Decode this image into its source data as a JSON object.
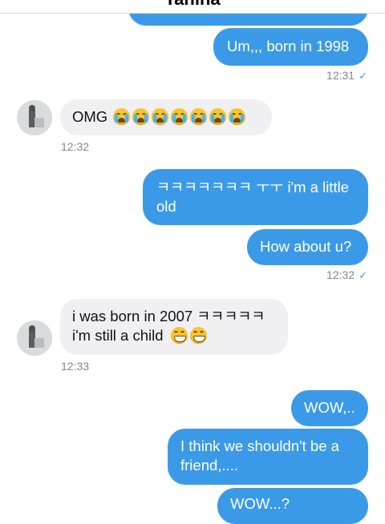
{
  "header": {
    "title": "Tahina"
  },
  "messages": {
    "m1": {
      "text": "Um,,, born in 1998"
    },
    "m1_time": "12:31",
    "m2": {
      "text": "OMG"
    },
    "m2_time": "12:32",
    "m3": {
      "line1": "ㅋㅋㅋㅋㅋㅋㅋ ㅜㅜ i'm a little",
      "line2": "old"
    },
    "m4": {
      "text": "How about u?"
    },
    "m4_time": "12:32",
    "m5": {
      "line1": "i was born in 2007 ㅋㅋㅋㅋㅋ",
      "line2": "i'm still a child"
    },
    "m5_time": "12:33",
    "m6": {
      "text": "WOW,.."
    },
    "m7": {
      "line1": "I think we shouldn't be a",
      "line2": "friend,...."
    },
    "m8": {
      "text": "WOW...?"
    }
  },
  "icons": {
    "read_receipt": "checkmark-icon",
    "crying": "loudly-crying-face-emoji",
    "grinning": "grinning-face-emoji"
  },
  "colors": {
    "outgoing": "#3b9ae8",
    "incoming": "#f0f0f3",
    "timestamp": "#7d8790"
  }
}
